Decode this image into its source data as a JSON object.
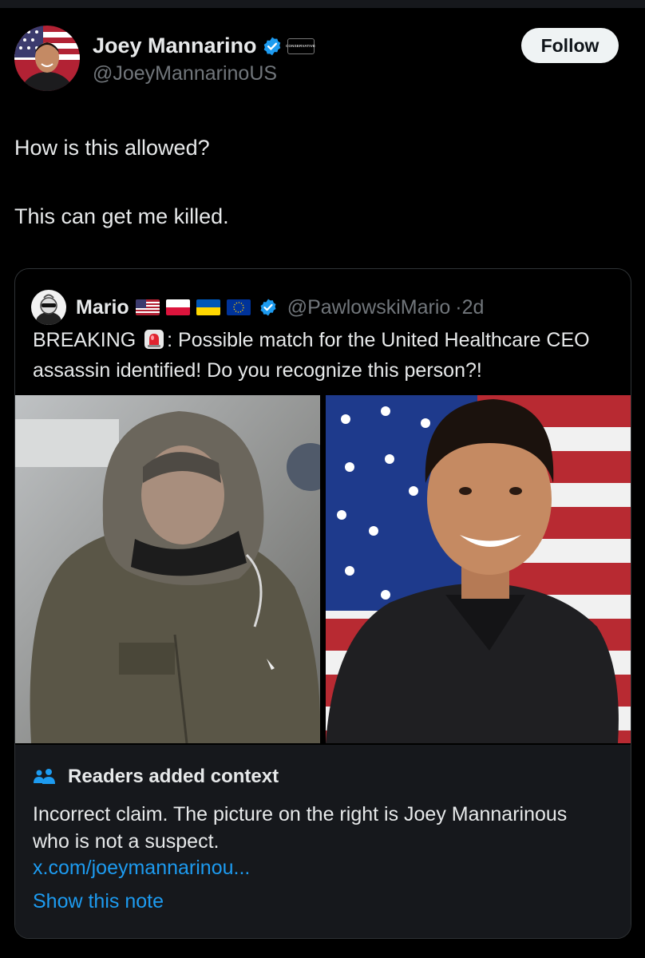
{
  "author": {
    "name": "Joey Mannarino",
    "handle": "@JoeyMannarinoUS",
    "affiliation_label": "CONSERVATIVE",
    "verified": true
  },
  "follow_label": "Follow",
  "tweet": {
    "line1": "How is this allowed?",
    "line2": "This can get me killed."
  },
  "quoted": {
    "name": "Mario",
    "flags": [
      "flag-us",
      "flag-poland",
      "flag-ukraine",
      "flag-eu"
    ],
    "handle": "@PawlowskiMario",
    "time": "·2d",
    "text_before": "BREAKING ",
    "text_after": ": Possible match for the United Healthcare CEO assassin identified! Do you recognize this person?!"
  },
  "community_note": {
    "title": "Readers added context",
    "body": "Incorrect claim. The picture on the right is Joey Mannarinous who is not a suspect.",
    "link": "x.com/joeymannarinou...",
    "show_label": "Show this note"
  },
  "colors": {
    "background": "#000000",
    "text": "#e7e9ea",
    "secondary": "#71767b",
    "accent": "#1d9bf0",
    "card_border": "#2f3336",
    "notes_bg": "#16181c"
  }
}
